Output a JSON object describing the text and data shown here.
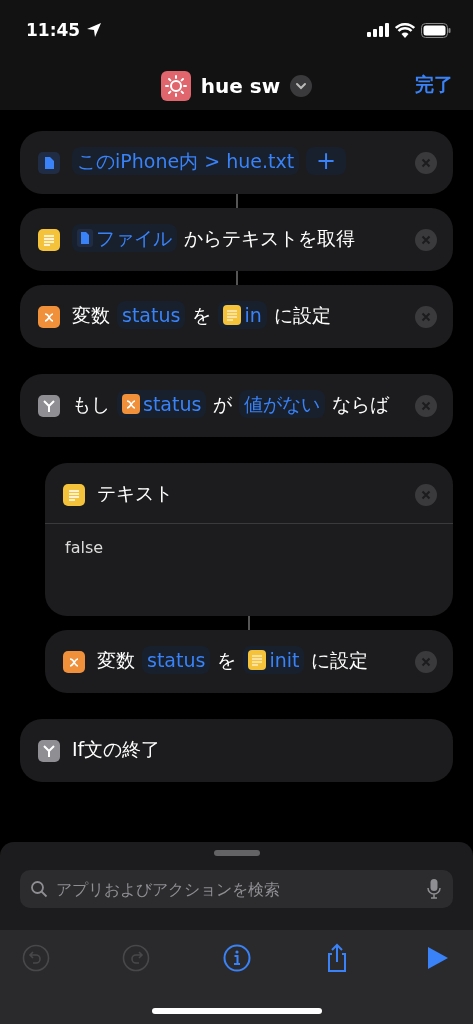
{
  "status_bar": {
    "time": "11:45"
  },
  "nav": {
    "title": "hue sw",
    "done": "完了"
  },
  "actions": [
    {
      "kind": "file",
      "segments": [
        {
          "kind": "param",
          "text": "このiPhone内 > hue.txt"
        },
        {
          "kind": "add-param",
          "text": "+"
        }
      ]
    },
    {
      "kind": "text",
      "linked": true,
      "segments": [
        {
          "kind": "file-param",
          "text": "ファイル"
        },
        {
          "kind": "word",
          "text": "からテキストを取得"
        }
      ]
    },
    {
      "kind": "variable",
      "linked": true,
      "segments": [
        {
          "kind": "word",
          "text": "変数"
        },
        {
          "kind": "param",
          "text": "status"
        },
        {
          "kind": "word",
          "text": "を"
        },
        {
          "kind": "text-param",
          "text": "in"
        },
        {
          "kind": "word",
          "text": "に設定"
        }
      ]
    },
    {
      "kind": "if",
      "linked": false,
      "segments": [
        {
          "kind": "word",
          "text": "もし"
        },
        {
          "kind": "var-param",
          "text": "status"
        },
        {
          "kind": "word",
          "text": "が"
        },
        {
          "kind": "param",
          "text": "値がない"
        },
        {
          "kind": "word",
          "text": "ならば"
        }
      ],
      "children": [
        {
          "kind": "text",
          "linked": false,
          "segments": [
            {
              "kind": "word",
              "text": "テキスト"
            }
          ],
          "body": "false"
        },
        {
          "kind": "variable",
          "linked": true,
          "segments": [
            {
              "kind": "word",
              "text": "変数"
            },
            {
              "kind": "param",
              "text": "status"
            },
            {
              "kind": "word",
              "text": "を"
            },
            {
              "kind": "text-param",
              "text": "init"
            },
            {
              "kind": "word",
              "text": "に設定"
            }
          ]
        }
      ]
    },
    {
      "kind": "if",
      "linked": false,
      "segments": [
        {
          "kind": "word",
          "text": "If文の終了"
        }
      ],
      "removable": false
    }
  ],
  "search": {
    "placeholder": "アプリおよびアクションを検索"
  },
  "toolbar": [
    {
      "kind": "undo",
      "disabled": true
    },
    {
      "kind": "redo",
      "disabled": true
    },
    {
      "kind": "info",
      "disabled": false
    },
    {
      "kind": "share",
      "disabled": false
    },
    {
      "kind": "run",
      "disabled": false
    }
  ]
}
